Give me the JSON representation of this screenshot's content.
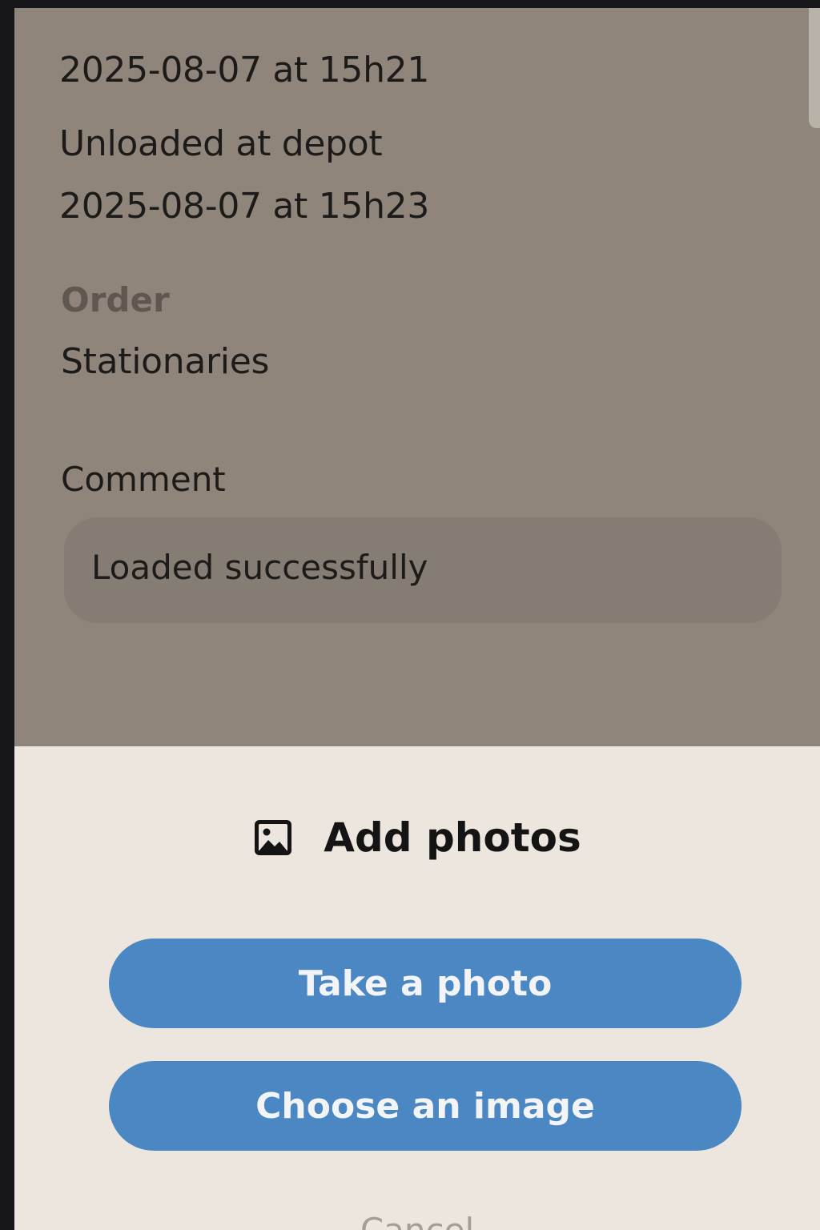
{
  "details": {
    "timestamp_1": "2025-08-07 at 15h21",
    "status": "Unloaded at depot",
    "timestamp_2": "2025-08-07 at 15h23"
  },
  "order": {
    "label": "Order",
    "value": "Stationaries"
  },
  "comment": {
    "label": "Comment",
    "value": "Loaded successfully"
  },
  "sheet": {
    "icon": "image-icon",
    "title": "Add photos",
    "take_photo_label": "Take a photo",
    "choose_image_label": "Choose an image",
    "cancel_label": "Cancel"
  },
  "colors": {
    "overlay_background": "#8f857a",
    "sheet_background": "#ece6de",
    "button_accent": "#4b87c2"
  }
}
